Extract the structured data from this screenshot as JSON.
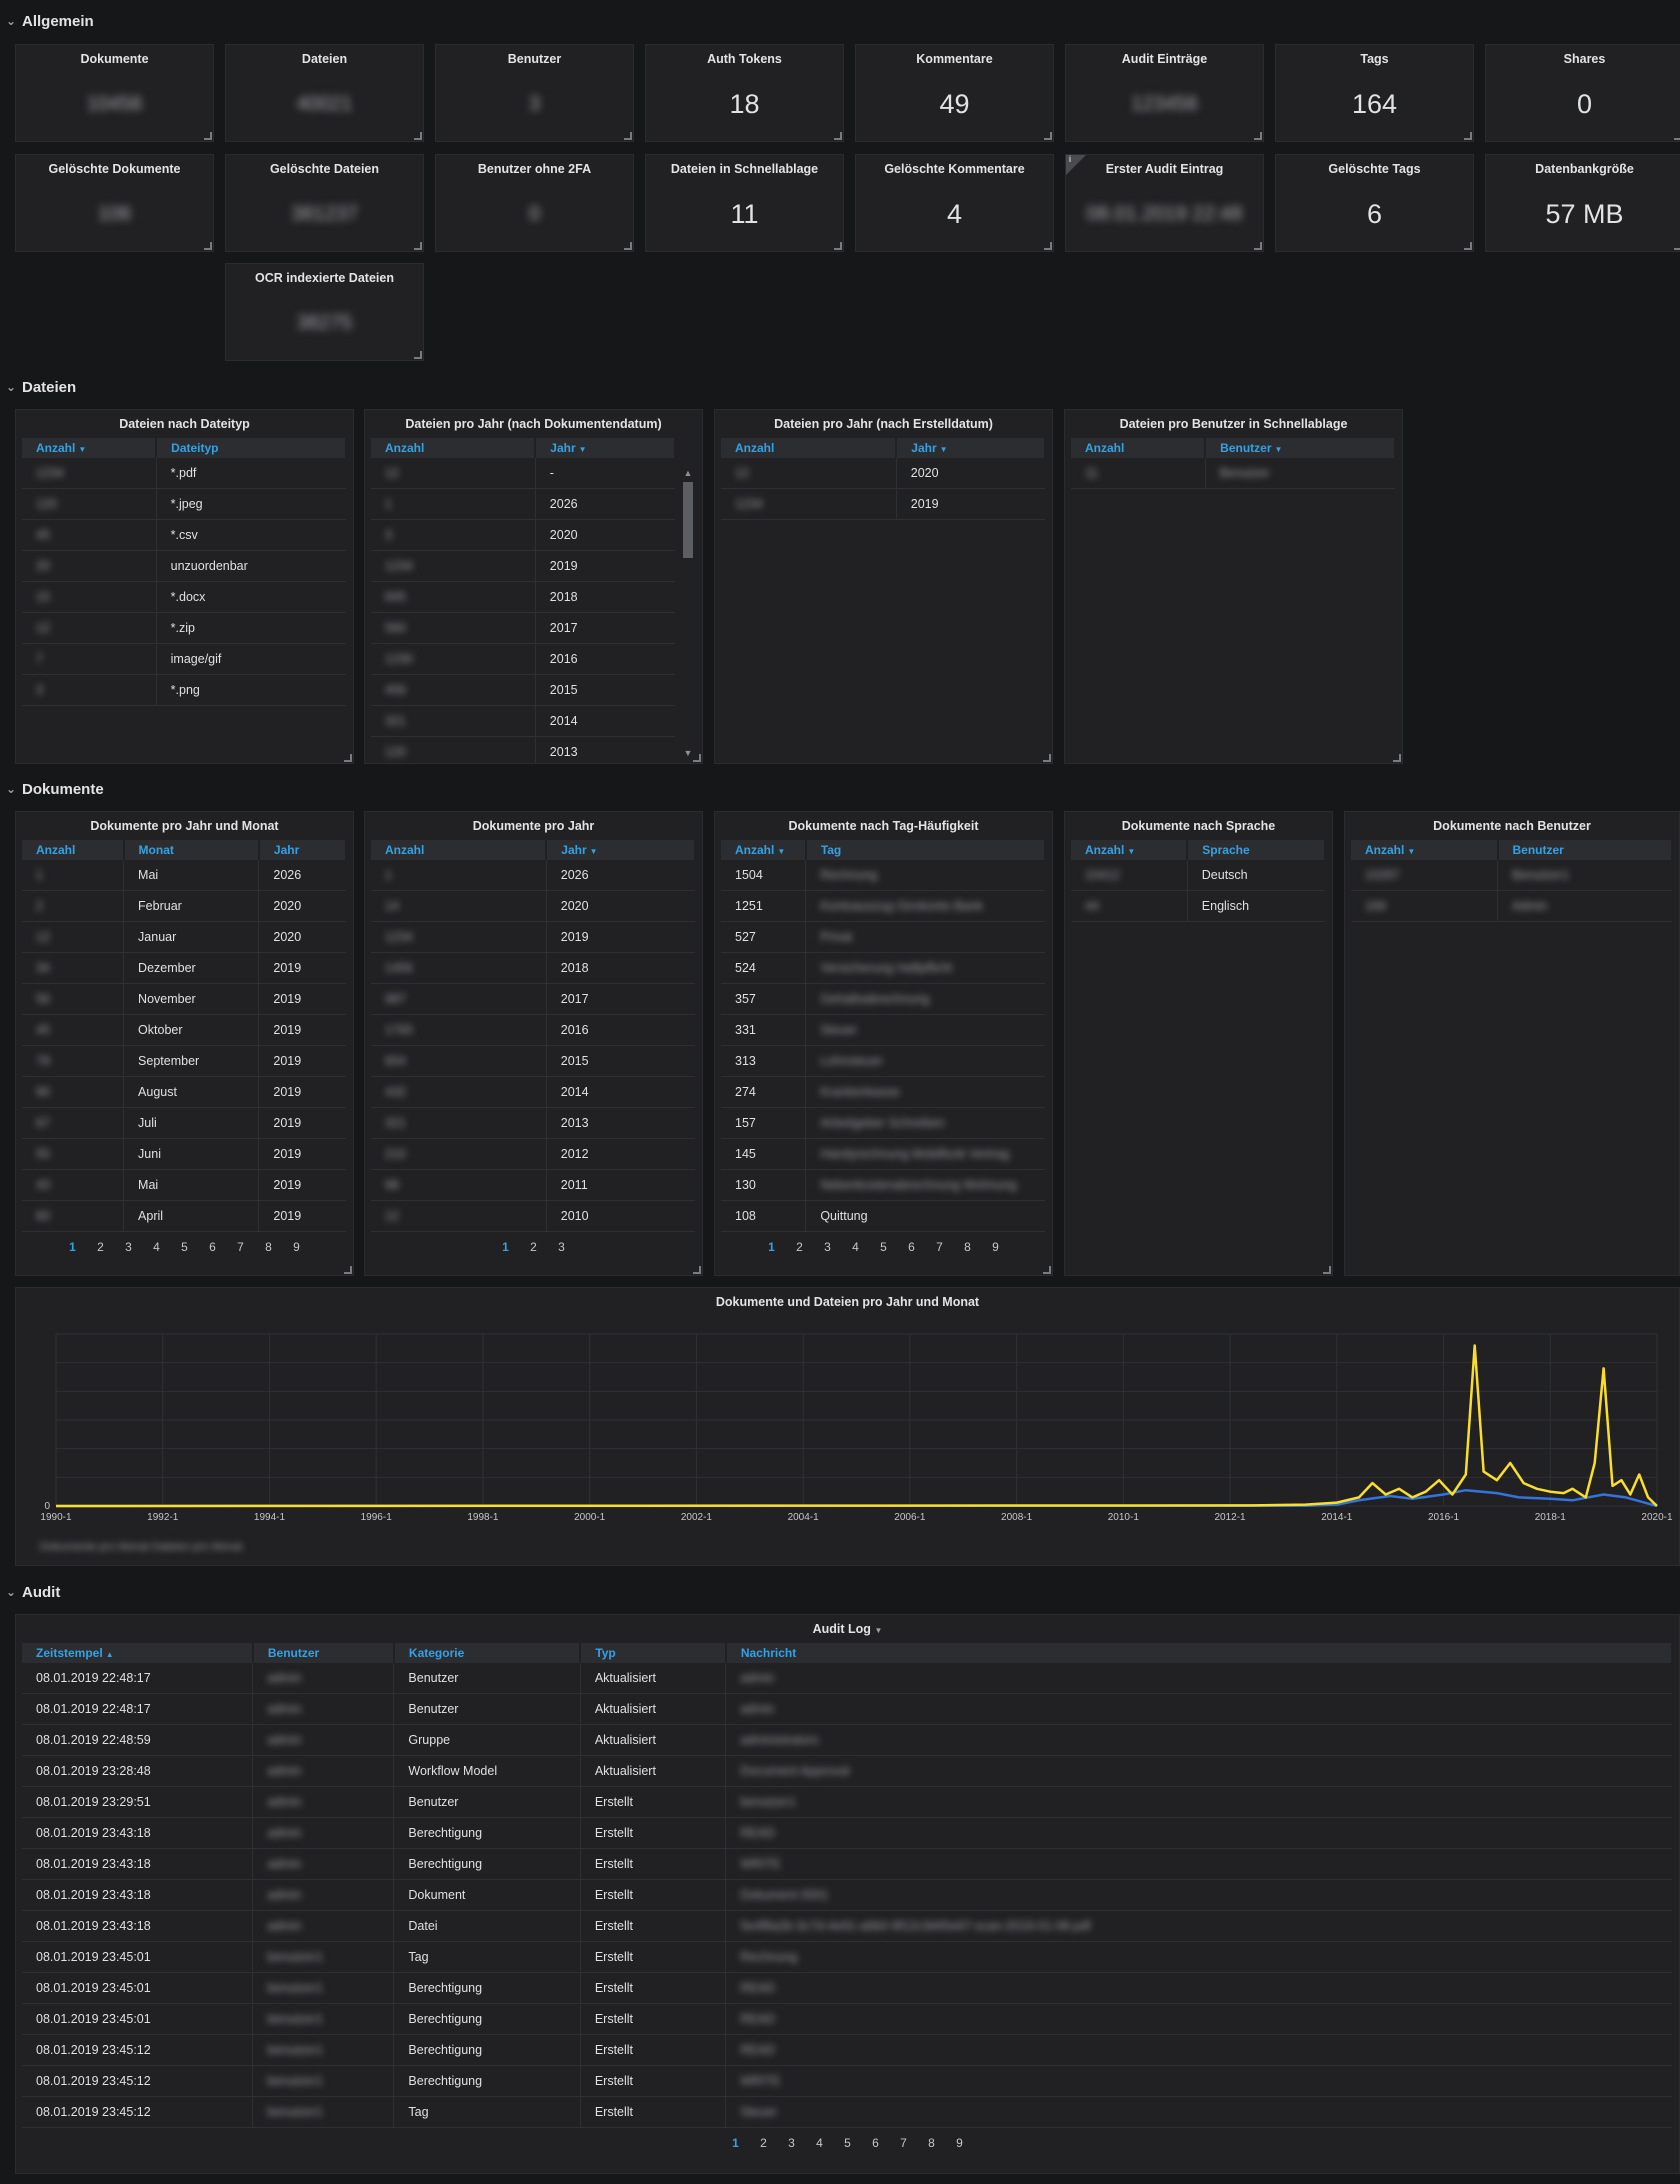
{
  "rows": {
    "allgemein": "Allgemein",
    "dateien": "Dateien",
    "dokumente": "Dokumente",
    "audit": "Audit"
  },
  "stats_row1": [
    {
      "title": "Dokumente",
      "value": "10456",
      "blur": true
    },
    {
      "title": "Dateien",
      "value": "40021",
      "blur": true
    },
    {
      "title": "Benutzer",
      "value": "3",
      "blur": true
    },
    {
      "title": "Auth Tokens",
      "value": "18",
      "blur": false
    },
    {
      "title": "Kommentare",
      "value": "49",
      "blur": false
    },
    {
      "title": "Audit Einträge",
      "value": "123456",
      "blur": true
    },
    {
      "title": "Tags",
      "value": "164",
      "blur": false
    },
    {
      "title": "Shares",
      "value": "0",
      "blur": false
    }
  ],
  "stats_row2": [
    {
      "title": "Gelöschte Dokumente",
      "value": "106",
      "blur": true
    },
    {
      "title": "Gelöschte Dateien",
      "value": "381237",
      "blur": true
    },
    {
      "title": "Benutzer ohne 2FA",
      "value": "0",
      "blur": true
    },
    {
      "title": "Dateien in Schnellablage",
      "value": "11",
      "blur": false
    },
    {
      "title": "Gelöschte Kommentare",
      "value": "4",
      "blur": false
    },
    {
      "title": "Erster Audit Eintrag",
      "value": "08.01.2019 22:48",
      "blur": true
    },
    {
      "title": "Gelöschte Tags",
      "value": "6",
      "blur": false
    },
    {
      "title": "Datenbankgröße",
      "value": "57 MB",
      "blur": false
    }
  ],
  "stats_row3": [
    {
      "title": "OCR indexierte Dateien",
      "value": "38275",
      "blur": true
    }
  ],
  "dateien_nach_typ": {
    "title": "Dateien nach Dateityp",
    "headers": [
      "Anzahl",
      "Dateityp"
    ],
    "rows": [
      [
        "1234",
        "*.pdf"
      ],
      [
        "120",
        "*.jpeg"
      ],
      [
        "45",
        "*.csv"
      ],
      [
        "20",
        "unzuordenbar"
      ],
      [
        "15",
        "*.docx"
      ],
      [
        "12",
        "*.zip"
      ],
      [
        "7",
        "image/gif"
      ],
      [
        "3",
        "*.png"
      ]
    ]
  },
  "dateien_pro_jahr_dok": {
    "title": "Dateien pro Jahr (nach Dokumentendatum)",
    "headers": [
      "Anzahl",
      "Jahr"
    ],
    "rows": [
      [
        "12",
        "-"
      ],
      [
        "1",
        "2026"
      ],
      [
        "3",
        "2020"
      ],
      [
        "1234",
        "2019"
      ],
      [
        "845",
        "2018"
      ],
      [
        "560",
        "2017"
      ],
      [
        "1230",
        "2016"
      ],
      [
        "456",
        "2015"
      ],
      [
        "321",
        "2014"
      ],
      [
        "120",
        "2013"
      ]
    ]
  },
  "dateien_pro_jahr_erst": {
    "title": "Dateien pro Jahr (nach Erstelldatum)",
    "headers": [
      "Anzahl",
      "Jahr"
    ],
    "rows": [
      [
        "12",
        "2020"
      ],
      [
        "1234",
        "2019"
      ]
    ]
  },
  "dateien_schnellablage": {
    "title": "Dateien pro Benutzer in Schnellablage",
    "headers": [
      "Anzahl",
      "Benutzer"
    ],
    "rows": [
      [
        "11",
        "Benutzer"
      ]
    ]
  },
  "dok_jahr_monat": {
    "title": "Dokumente pro Jahr und Monat",
    "headers": [
      "Anzahl",
      "Monat",
      "Jahr"
    ],
    "rows": [
      [
        "1",
        "Mai",
        "2026"
      ],
      [
        "2",
        "Februar",
        "2020"
      ],
      [
        "12",
        "Januar",
        "2020"
      ],
      [
        "34",
        "Dezember",
        "2019"
      ],
      [
        "56",
        "November",
        "2019"
      ],
      [
        "45",
        "Oktober",
        "2019"
      ],
      [
        "78",
        "September",
        "2019"
      ],
      [
        "90",
        "August",
        "2019"
      ],
      [
        "67",
        "Juli",
        "2019"
      ],
      [
        "55",
        "Juni",
        "2019"
      ],
      [
        "43",
        "Mai",
        "2019"
      ],
      [
        "60",
        "April",
        "2019"
      ]
    ],
    "pages": [
      "1",
      "2",
      "3",
      "4",
      "5",
      "6",
      "7",
      "8",
      "9"
    ]
  },
  "dok_pro_jahr": {
    "title": "Dokumente pro Jahr",
    "headers": [
      "Anzahl",
      "Jahr"
    ],
    "rows": [
      [
        "1",
        "2026"
      ],
      [
        "14",
        "2020"
      ],
      [
        "1234",
        "2019"
      ],
      [
        "1456",
        "2018"
      ],
      [
        "987",
        "2017"
      ],
      [
        "1765",
        "2016"
      ],
      [
        "654",
        "2015"
      ],
      [
        "432",
        "2014"
      ],
      [
        "321",
        "2013"
      ],
      [
        "210",
        "2012"
      ],
      [
        "98",
        "2011"
      ],
      [
        "12",
        "2010"
      ]
    ],
    "pages": [
      "1",
      "2",
      "3"
    ]
  },
  "dok_tag": {
    "title": "Dokumente nach Tag-Häufigkeit",
    "headers": [
      "Anzahl",
      "Tag"
    ],
    "rows": [
      [
        "1504",
        "Rechnung"
      ],
      [
        "1251",
        "Kontoauszug Girokonto Bank"
      ],
      [
        "527",
        "Privat"
      ],
      [
        "524",
        "Versicherung Haftpflicht"
      ],
      [
        "357",
        "Gehaltsabrechnung"
      ],
      [
        "331",
        "Steuer"
      ],
      [
        "313",
        "Lohnsteuer"
      ],
      [
        "274",
        "Krankenkasse"
      ],
      [
        "157",
        "Arbeitgeber Schreiben"
      ],
      [
        "145",
        "Handyrechnung Mobilfunk Vertrag"
      ],
      [
        "130",
        "Nebenkostenabrechnung Wohnung"
      ],
      [
        "108",
        "Quittung"
      ]
    ],
    "pages": [
      "1",
      "2",
      "3",
      "4",
      "5",
      "6",
      "7",
      "8",
      "9"
    ]
  },
  "dok_sprache": {
    "title": "Dokumente nach Sprache",
    "headers": [
      "Anzahl",
      "Sprache"
    ],
    "rows": [
      [
        "10412",
        "Deutsch"
      ],
      [
        "44",
        "Englisch"
      ]
    ]
  },
  "dok_benutzer": {
    "title": "Dokumente nach Benutzer",
    "headers": [
      "Anzahl",
      "Benutzer"
    ],
    "rows": [
      [
        "10287",
        "Benutzer1"
      ],
      [
        "169",
        "Admin"
      ]
    ]
  },
  "timeline": {
    "title": "Dokumente und Dateien pro Jahr und Monat",
    "legend": "Dokumente pro Monat   Dateien pro Monat"
  },
  "chart_data": {
    "type": "line",
    "title": "Dokumente und Dateien pro Jahr und Monat",
    "x_tick_labels": [
      "1990-1",
      "1992-1",
      "1994-1",
      "1996-1",
      "1998-1",
      "2000-1",
      "2002-1",
      "2004-1",
      "2006-1",
      "2008-1",
      "2010-1",
      "2012-1",
      "2014-1",
      "2016-1",
      "2018-1",
      "2020-1"
    ],
    "y_tick_labels": [
      "0"
    ],
    "xlim": [
      "1990-01",
      "2020-01"
    ],
    "series": [
      {
        "color": "#fade2a",
        "x": [
          "1990-01",
          "2012-06",
          "2013-06",
          "2014-01",
          "2014-06",
          "2014-09",
          "2014-12",
          "2015-03",
          "2015-06",
          "2015-09",
          "2015-12",
          "2016-03",
          "2016-06",
          "2016-08",
          "2016-10",
          "2017-01",
          "2017-04",
          "2017-07",
          "2017-10",
          "2018-01",
          "2018-04",
          "2018-06",
          "2018-09",
          "2018-11",
          "2019-01",
          "2019-03",
          "2019-05",
          "2019-07",
          "2019-09",
          "2019-11",
          "2020-01"
        ],
        "y": [
          0,
          2,
          5,
          12,
          30,
          80,
          40,
          60,
          30,
          50,
          90,
          40,
          110,
          560,
          120,
          90,
          150,
          80,
          60,
          50,
          45,
          60,
          30,
          150,
          480,
          70,
          90,
          40,
          110,
          30,
          0
        ]
      },
      {
        "color": "#3274d9",
        "x": [
          "1990-01",
          "2013-06",
          "2014-01",
          "2014-06",
          "2015-01",
          "2015-06",
          "2016-01",
          "2016-06",
          "2017-01",
          "2017-06",
          "2018-01",
          "2018-06",
          "2019-01",
          "2019-06",
          "2020-01"
        ],
        "y": [
          0,
          1,
          5,
          20,
          35,
          25,
          40,
          55,
          45,
          30,
          25,
          20,
          40,
          30,
          0
        ]
      }
    ]
  },
  "audit": {
    "title": "Audit Log",
    "headers": [
      "Zeitstempel",
      "Benutzer",
      "Kategorie",
      "Typ",
      "Nachricht"
    ],
    "rows": [
      [
        "08.01.2019 22:48:17",
        "admin",
        "Benutzer",
        "Aktualisiert",
        "admin"
      ],
      [
        "08.01.2019 22:48:17",
        "admin",
        "Benutzer",
        "Aktualisiert",
        "admin"
      ],
      [
        "08.01.2019 22:48:59",
        "admin",
        "Gruppe",
        "Aktualisiert",
        "administrators"
      ],
      [
        "08.01.2019 23:28:48",
        "admin",
        "Workflow Model",
        "Aktualisiert",
        "Document Approval"
      ],
      [
        "08.01.2019 23:29:51",
        "admin",
        "Benutzer",
        "Erstellt",
        "benutzer1"
      ],
      [
        "08.01.2019 23:43:18",
        "admin",
        "Berechtigung",
        "Erstellt",
        "READ"
      ],
      [
        "08.01.2019 23:43:18",
        "admin",
        "Berechtigung",
        "Erstellt",
        "WRITE"
      ],
      [
        "08.01.2019 23:43:18",
        "admin",
        "Dokument",
        "Erstellt",
        "Dokument 0001"
      ],
      [
        "08.01.2019 23:43:18",
        "admin",
        "Datei",
        "Erstellt",
        "5e4f8a2b-3c7d-4e91-a6b0-9f12c3d45e67-scan-2019-01-08.pdf"
      ],
      [
        "08.01.2019 23:45:01",
        "benutzer1",
        "Tag",
        "Erstellt",
        "Rechnung"
      ],
      [
        "08.01.2019 23:45:01",
        "benutzer1",
        "Berechtigung",
        "Erstellt",
        "READ"
      ],
      [
        "08.01.2019 23:45:01",
        "benutzer1",
        "Berechtigung",
        "Erstellt",
        "READ"
      ],
      [
        "08.01.2019 23:45:12",
        "benutzer1",
        "Berechtigung",
        "Erstellt",
        "READ"
      ],
      [
        "08.01.2019 23:45:12",
        "benutzer1",
        "Berechtigung",
        "Erstellt",
        "WRITE"
      ],
      [
        "08.01.2019 23:45:12",
        "benutzer1",
        "Tag",
        "Erstellt",
        "Steuer"
      ]
    ],
    "pages": [
      "1",
      "2",
      "3",
      "4",
      "5",
      "6",
      "7",
      "8",
      "9"
    ]
  }
}
